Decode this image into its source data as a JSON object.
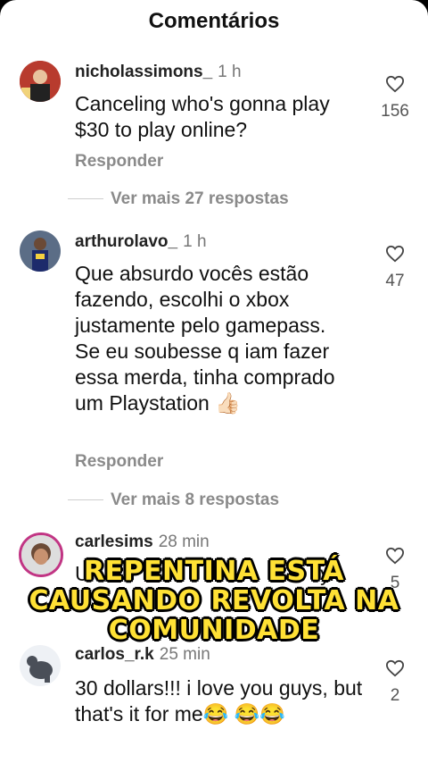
{
  "header": {
    "title": "Comentários"
  },
  "comments": [
    {
      "username": "nicholassimons_",
      "time": "1 h",
      "text": "Canceling who's gonna play $30 to play online?",
      "likes": "156",
      "reply_label": "Responder",
      "more_replies": "Ver mais 27 respostas"
    },
    {
      "username": "arthurolavo_",
      "time": "1 h",
      "text": "Que absurdo vocês estão fazendo, escolhi o xbox justamente pelo gamepass. Se eu soubesse q iam fazer essa merda, tinha comprado um Playstation 👍🏻",
      "likes": "47",
      "reply_label": "Responder",
      "more_replies": "Ver mais 8 respostas"
    },
    {
      "username": "carlesims",
      "time": "28 min",
      "text": "Un",
      "text_end": "ly.",
      "likes": "5"
    },
    {
      "username": "carlos_r.k",
      "time": "25 min",
      "text": "30 dollars!!! i love you guys, but that's it for me😂 😂😂",
      "likes": "2"
    }
  ],
  "overlay_caption": {
    "line1": "REPENTINA ESTÁ",
    "line2": "CAUSANDO REVOLTA NA",
    "line3": "COMUNIDADE"
  },
  "icons": {
    "like": "heart-icon"
  },
  "colors": {
    "accent_avatar_ring": "#c13584",
    "caption": "#ffe135"
  }
}
